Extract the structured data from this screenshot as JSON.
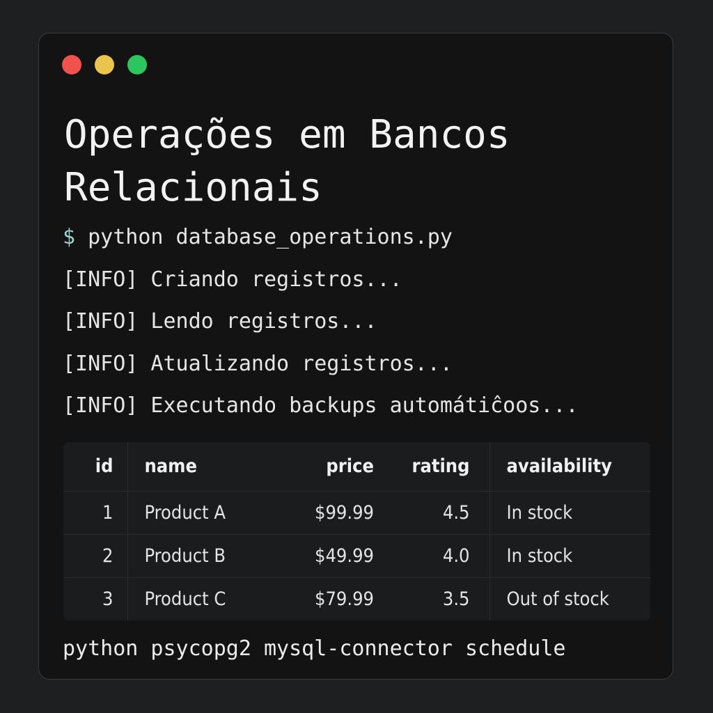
{
  "window": {
    "controls": [
      {
        "name": "close",
        "color": "#f0524d"
      },
      {
        "name": "minimize",
        "color": "#e9c54d"
      },
      {
        "name": "maximize",
        "color": "#2dc55e"
      }
    ]
  },
  "title": "Operações em Bancos Relacionais",
  "terminal": {
    "prompt": "$",
    "command": "python database_operations.py",
    "logs": [
      "[INFO] Criando registros...",
      "[INFO] Lendo registros...",
      "[INFO] Atualizando registros...",
      "[INFO] Executando backups automátiĉoos..."
    ]
  },
  "table": {
    "headers": [
      "id",
      "name",
      "price",
      "rating",
      "availability"
    ],
    "rows": [
      {
        "id": "1",
        "name": "Product A",
        "price": "$99.99",
        "rating": "4.5",
        "availability": "In stock"
      },
      {
        "id": "2",
        "name": "Product B",
        "price": "$49.99",
        "rating": "4.0",
        "availability": "In stock"
      },
      {
        "id": "3",
        "name": "Product C",
        "price": "$79.99",
        "rating": "3.5",
        "availability": "Out of stock"
      }
    ]
  },
  "footer": "python psycopg2 mysql-connector schedule"
}
